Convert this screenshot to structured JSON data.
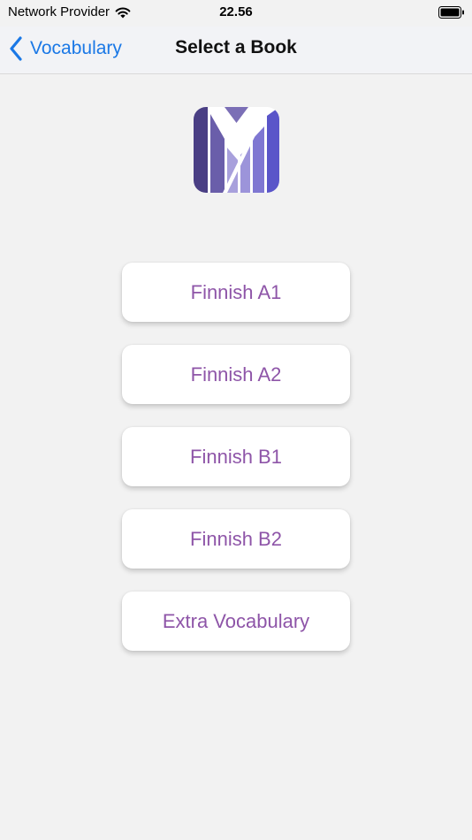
{
  "status_bar": {
    "carrier": "Network Provider",
    "time": "22.56"
  },
  "nav": {
    "back_label": "Vocabulary",
    "title": "Select a Book"
  },
  "logo": {
    "icon": "app-logo-icon",
    "colors": [
      "#4a3f84",
      "#6a5eaa",
      "#8f86cf",
      "#5a55c9"
    ]
  },
  "books": [
    {
      "label": "Finnish A1"
    },
    {
      "label": "Finnish A2"
    },
    {
      "label": "Finnish B1"
    },
    {
      "label": "Finnish B2"
    },
    {
      "label": "Extra Vocabulary"
    }
  ],
  "colors": {
    "accent_blue": "#1a78e6",
    "book_text": "#8e55a8",
    "background": "#f2f2f2"
  }
}
